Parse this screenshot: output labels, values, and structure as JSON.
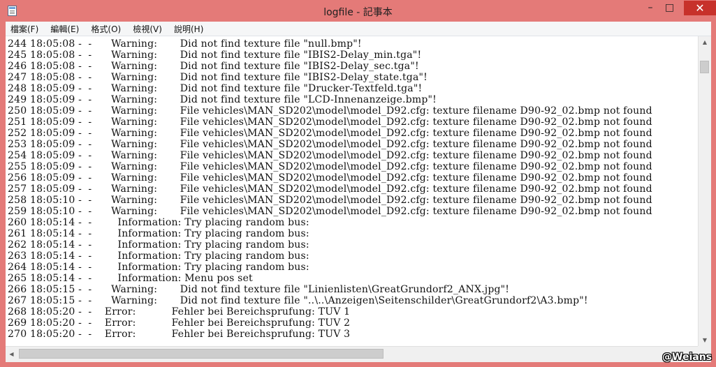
{
  "window": {
    "title": "logfile - 記事本",
    "buttons": {
      "minimize": "–",
      "maximize": "□",
      "close": "✕"
    }
  },
  "menu": {
    "file": "檔案(F)",
    "edit": "編輯(E)",
    "format": "格式(O)",
    "view": "檢視(V)",
    "help": "說明(H)"
  },
  "log_lines": [
    "244 18:05:08 -  -      Warning:       Did not find texture file \"null.bmp\"!",
    "245 18:05:08 -  -      Warning:       Did not find texture file \"IBIS2-Delay_min.tga\"!",
    "246 18:05:08 -  -      Warning:       Did not find texture file \"IBIS2-Delay_sec.tga\"!",
    "247 18:05:08 -  -      Warning:       Did not find texture file \"IBIS2-Delay_state.tga\"!",
    "248 18:05:09 -  -      Warning:       Did not find texture file \"Drucker-Textfeld.tga\"!",
    "249 18:05:09 -  -      Warning:       Did not find texture file \"LCD-Innenanzeige.bmp\"!",
    "250 18:05:09 -  -      Warning:       File vehicles\\MAN_SD202\\model\\model_D92.cfg: texture filename D90-92_02.bmp not found",
    "251 18:05:09 -  -      Warning:       File vehicles\\MAN_SD202\\model\\model_D92.cfg: texture filename D90-92_02.bmp not found",
    "252 18:05:09 -  -      Warning:       File vehicles\\MAN_SD202\\model\\model_D92.cfg: texture filename D90-92_02.bmp not found",
    "253 18:05:09 -  -      Warning:       File vehicles\\MAN_SD202\\model\\model_D92.cfg: texture filename D90-92_02.bmp not found",
    "254 18:05:09 -  -      Warning:       File vehicles\\MAN_SD202\\model\\model_D92.cfg: texture filename D90-92_02.bmp not found",
    "255 18:05:09 -  -      Warning:       File vehicles\\MAN_SD202\\model\\model_D92.cfg: texture filename D90-92_02.bmp not found",
    "256 18:05:09 -  -      Warning:       File vehicles\\MAN_SD202\\model\\model_D92.cfg: texture filename D90-92_02.bmp not found",
    "257 18:05:09 -  -      Warning:       File vehicles\\MAN_SD202\\model\\model_D92.cfg: texture filename D90-92_02.bmp not found",
    "258 18:05:10 -  -      Warning:       File vehicles\\MAN_SD202\\model\\model_D92.cfg: texture filename D90-92_02.bmp not found",
    "259 18:05:10 -  -      Warning:       File vehicles\\MAN_SD202\\model\\model_D92.cfg: texture filename D90-92_02.bmp not found",
    "260 18:05:14 -  -        Information: Try placing random bus:",
    "261 18:05:14 -  -        Information: Try placing random bus:",
    "262 18:05:14 -  -        Information: Try placing random bus:",
    "263 18:05:14 -  -        Information: Try placing random bus:",
    "264 18:05:14 -  -        Information: Try placing random bus:",
    "265 18:05:14 -  -        Information: Menu pos set",
    "266 18:05:15 -  -      Warning:       Did not find texture file \"Linienlisten\\GreatGrundorf2_ANX.jpg\"!",
    "267 18:05:15 -  -      Warning:       Did not find texture file \"..\\..\\Anzeigen\\Seitenschilder\\GreatGrundorf2\\A3.bmp\"!",
    "268 18:05:20 -  -    Error:           Fehler bei Bereichsprufung: TUV 1",
    "269 18:05:20 -  -    Error:           Fehler bei Bereichsprufung: TUV 2",
    "270 18:05:20 -  -    Error:           Fehler bei Bereichsprufung: TUV 3"
  ],
  "watermark": "@Weians",
  "icons": {
    "app": "notepad-icon",
    "scroll_up": "arrow-up-icon",
    "scroll_down": "arrow-down-icon",
    "scroll_left": "arrow-left-icon",
    "scroll_right": "arrow-right-icon"
  },
  "colors": {
    "titlebar": "#e47a78",
    "close_button": "#c7312b",
    "editor_bg": "#ffffff"
  }
}
